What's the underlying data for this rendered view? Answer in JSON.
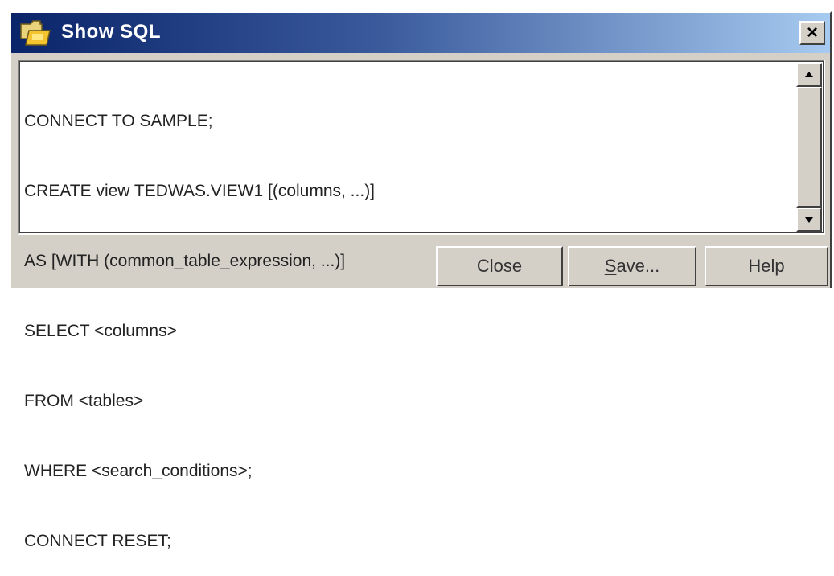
{
  "window": {
    "title": "Show SQL",
    "close_glyph": "×"
  },
  "icons": {
    "app": "folder-icon",
    "close": "close-icon",
    "scroll_up": "arrow-up-icon",
    "scroll_down": "arrow-down-icon"
  },
  "sql": {
    "lines": [
      "CONNECT TO SAMPLE;",
      "CREATE view TEDWAS.VIEW1 [(columns, ...)]",
      "AS [WITH (common_table_expression, ...)]",
      "SELECT <columns>",
      "FROM <tables>",
      "WHERE <search_conditions>;",
      "CONNECT RESET;"
    ]
  },
  "buttons": {
    "close_label": "Close",
    "save_label_mnemonic": "S",
    "save_label_rest": "ave...",
    "help_label": "Help"
  },
  "colors": {
    "titlebar_start": "#0a246a",
    "titlebar_end": "#a6caf0",
    "window_bg": "#d4d0c8"
  }
}
